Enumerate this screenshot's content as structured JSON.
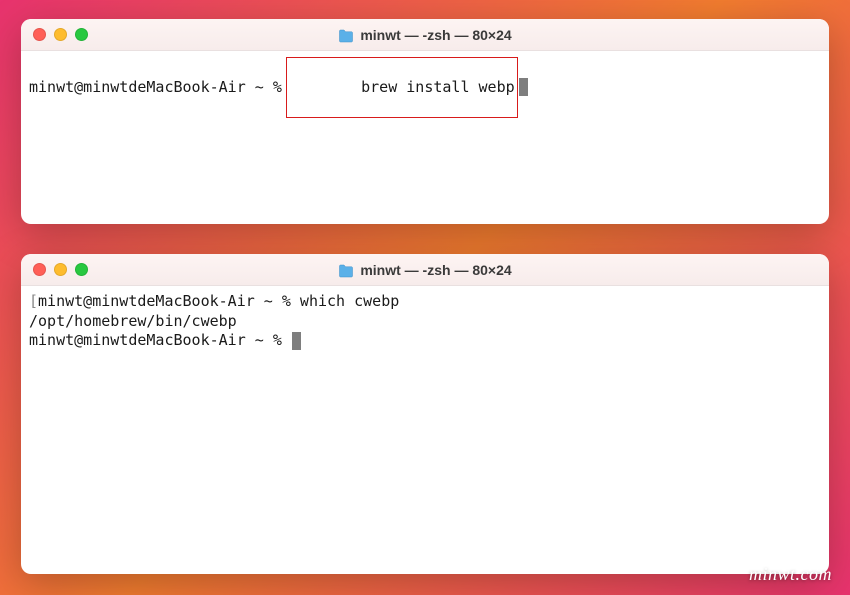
{
  "window1": {
    "title": "minwt — -zsh — 80×24",
    "prompt": "minwt@minwtdeMacBook-Air ~ %",
    "command": "brew install webp"
  },
  "window2": {
    "title": "minwt — -zsh — 80×24",
    "line1_prompt": "minwt@minwtdeMacBook-Air ~ %",
    "line1_command": " which cwebp",
    "line2": "/opt/homebrew/bin/cwebp",
    "line3_prompt": "minwt@minwtdeMacBook-Air ~ % "
  },
  "watermark": "minwt.com"
}
